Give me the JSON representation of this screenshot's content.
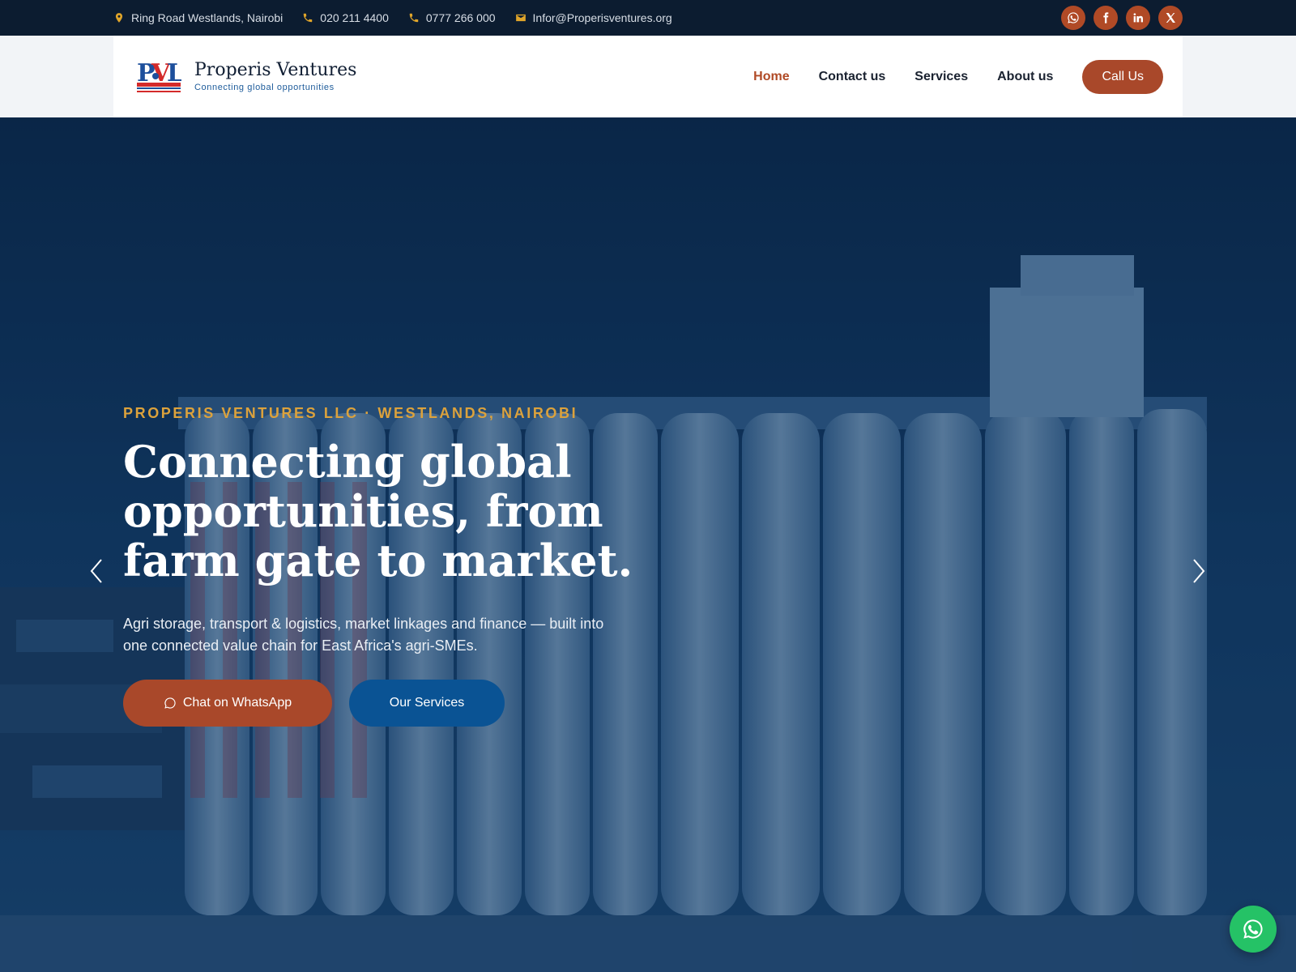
{
  "topbar": {
    "address": "Ring Road Westlands, Nairobi",
    "phone1": "020 211 4400",
    "phone2": "0777 266 000",
    "email": "Infor@Properisventures.org",
    "socials": [
      "whatsapp-icon",
      "facebook-icon",
      "linkedin-icon",
      "x-icon"
    ]
  },
  "brand": {
    "name": "Properis Ventures",
    "tagline": "Connecting global opportunities",
    "logo_text": "PVL"
  },
  "nav": {
    "items": [
      {
        "label": "Home",
        "active": true
      },
      {
        "label": "Contact us",
        "active": false
      },
      {
        "label": "Services",
        "active": false
      },
      {
        "label": "About us",
        "active": false
      }
    ],
    "cta": "Call Us"
  },
  "hero": {
    "eyebrow": "PROPERIS VENTURES LLC · WESTLANDS, NAIROBI",
    "headline": "Connecting global opportunities, from farm gate to market.",
    "subtext": "Agri storage, transport & logistics, market linkages and finance — built into one connected value chain for East Africa's agri-SMEs.",
    "primary_button": "Chat on WhatsApp",
    "secondary_button": "Our Services"
  },
  "colors": {
    "topbar_bg": "#0c1c30",
    "accent": "#a9482a",
    "brand_blue": "#0a5394",
    "gold": "#dca23c",
    "whatsapp_green": "#25c266"
  }
}
